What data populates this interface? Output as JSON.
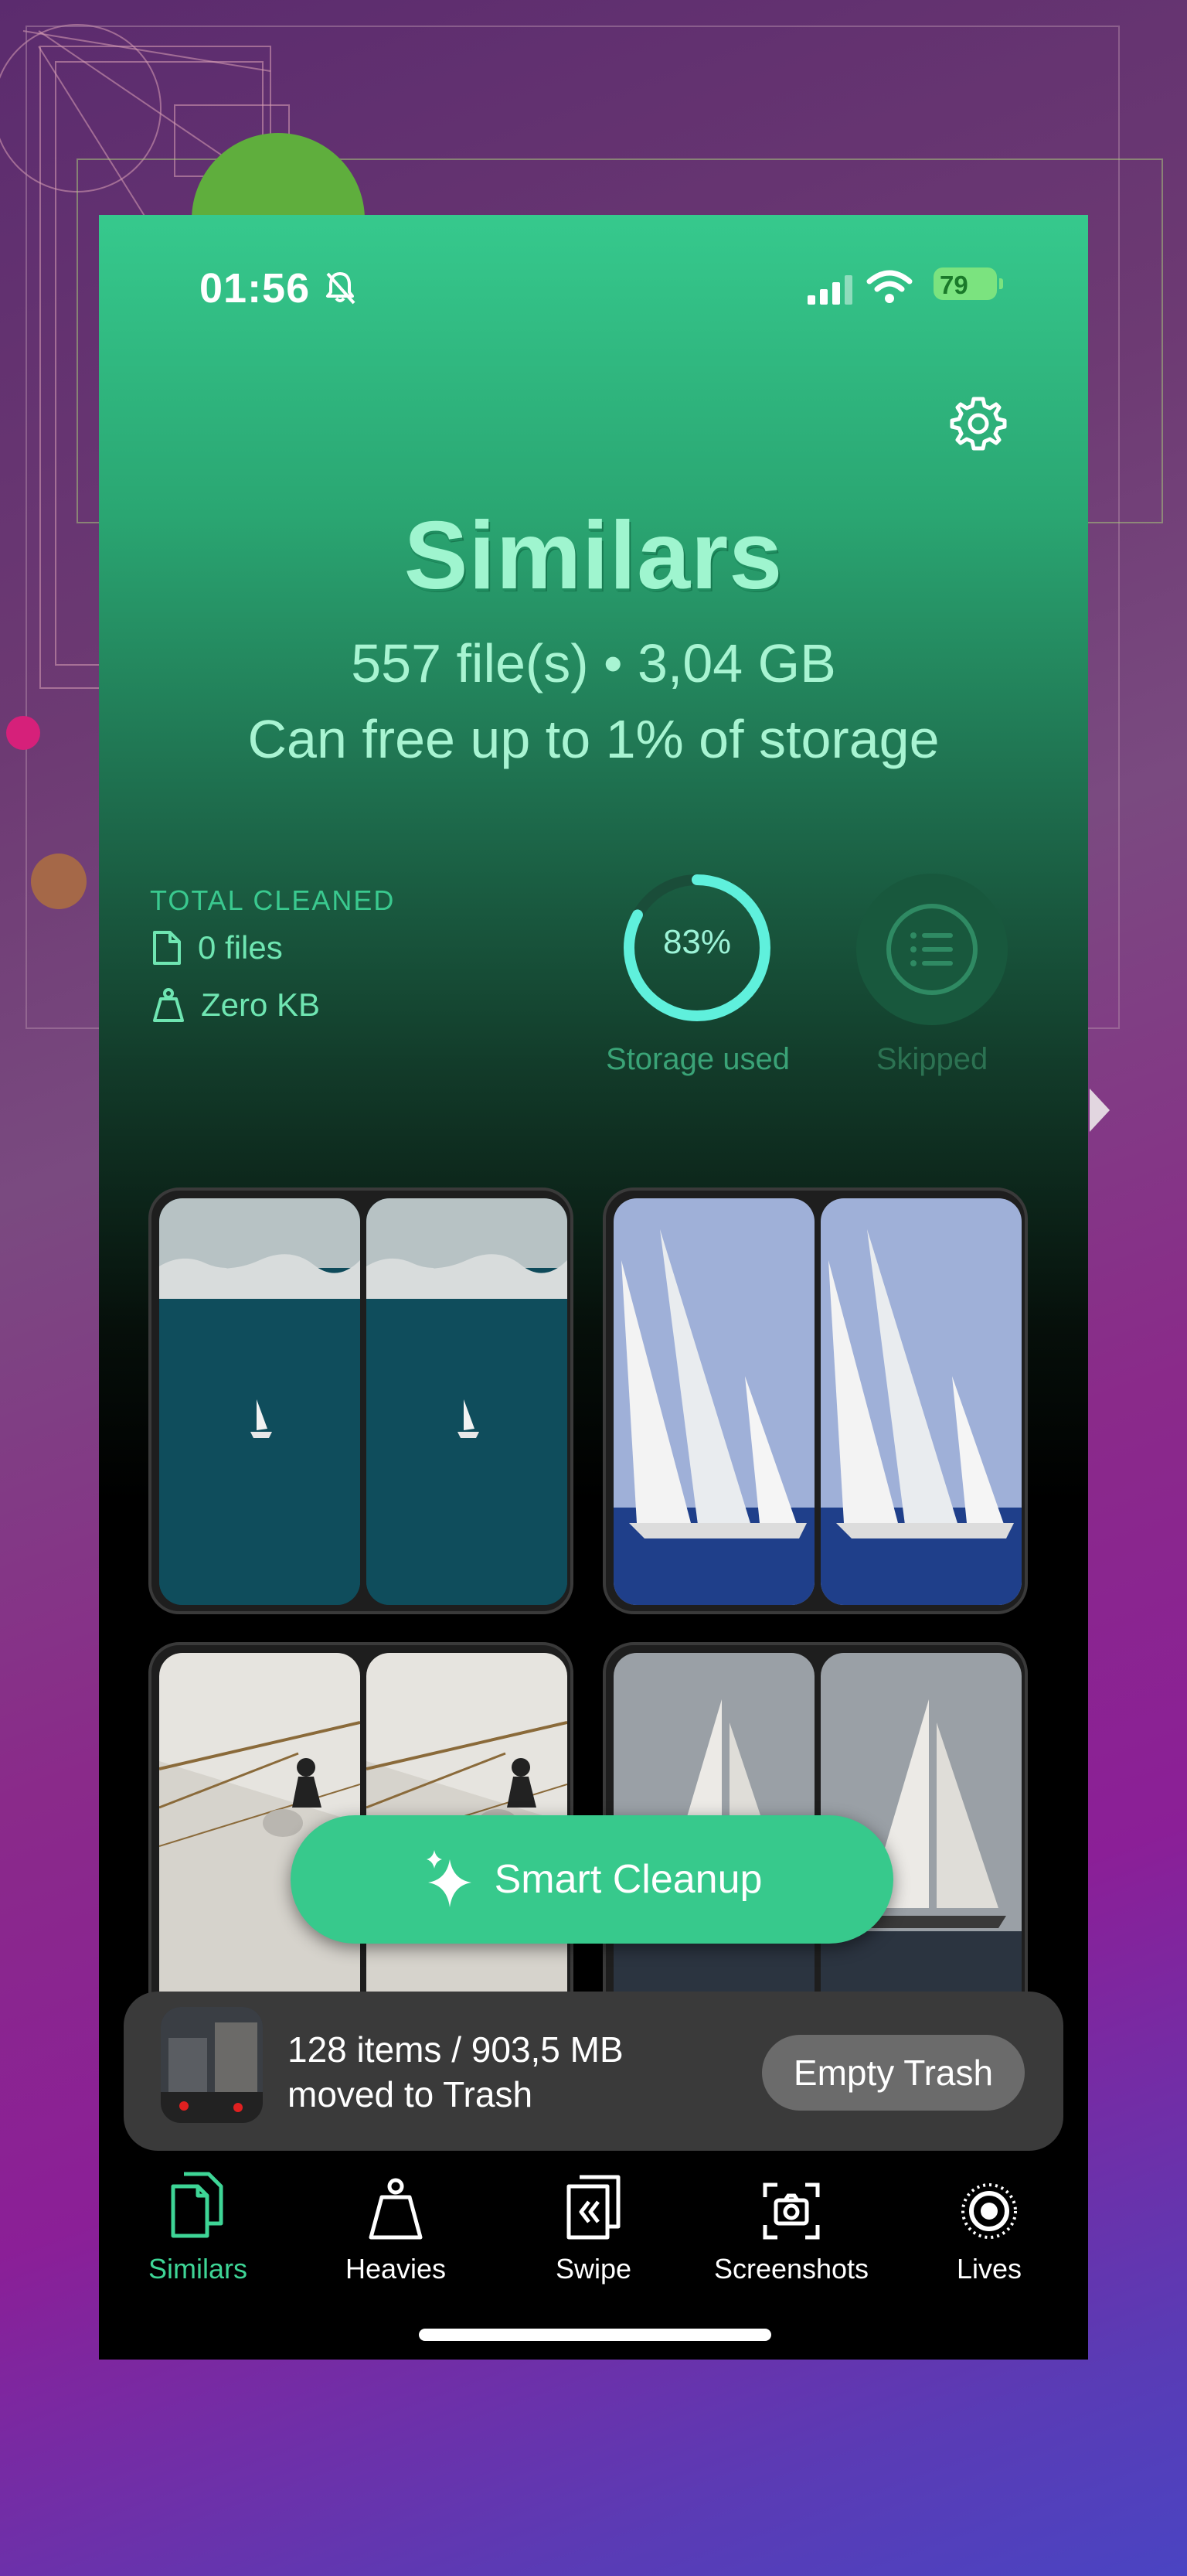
{
  "status_bar": {
    "time": "01:56",
    "battery": "79"
  },
  "header": {
    "title": "Similars",
    "file_summary": "557 file(s) • 3,04 GB",
    "free_summary": "Can free up to 1% of storage"
  },
  "stats": {
    "total_cleaned_label": "TOTAL CLEANED",
    "files": "0 files",
    "size": "Zero KB",
    "storage_percent": "83%",
    "storage_used_fraction": 0.83,
    "storage_label": "Storage used",
    "skipped_label": "Skipped"
  },
  "groups": [
    {
      "subject": "sailboat on open sea"
    },
    {
      "subject": "racing yachts under sail"
    },
    {
      "subject": "crew on mast rigging"
    },
    {
      "subject": "classic sailing yachts"
    }
  ],
  "smart_cleanup": {
    "label": "Smart Cleanup"
  },
  "trash": {
    "line1": "128 items / 903,5 MB",
    "line2": "moved to Trash",
    "button": "Empty Trash"
  },
  "tabs": [
    {
      "label": "Similars",
      "icon": "similars-icon",
      "active": true
    },
    {
      "label": "Heavies",
      "icon": "weight-icon",
      "active": false
    },
    {
      "label": "Swipe",
      "icon": "swipe-icon",
      "active": false
    },
    {
      "label": "Screenshots",
      "icon": "screenshot-icon",
      "active": false
    },
    {
      "label": "Lives",
      "icon": "live-photo-icon",
      "active": false
    }
  ],
  "colors": {
    "accent": "#37c98c",
    "active_tab": "#3ed596",
    "title": "#9ff5cf"
  }
}
